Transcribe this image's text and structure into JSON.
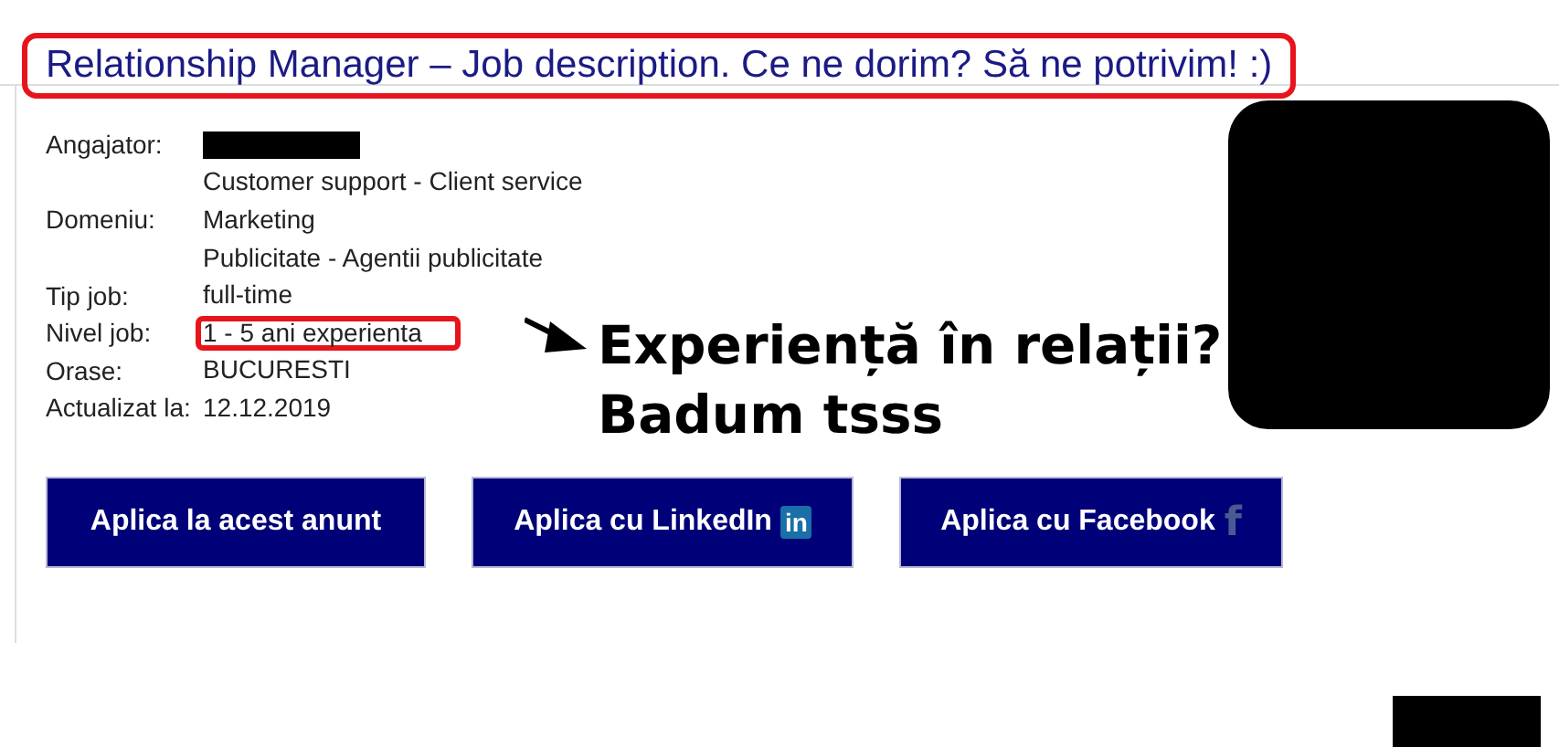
{
  "title": {
    "text": "Relationship Manager – Job description. Ce ne dorim? Să ne potrivim! :)",
    "highlighted": true
  },
  "details": [
    {
      "label": "Angajator:",
      "kind": "redacted"
    },
    {
      "value": "Customer support - Client service",
      "kind": "text"
    },
    {
      "label": "Domeniu:",
      "value": "Marketing",
      "kind": "text"
    },
    {
      "value": "Publicitate - Agentii publicitate",
      "kind": "text"
    },
    {
      "label": "Tip job:",
      "value": "full-time",
      "kind": "text"
    },
    {
      "label": "Nivel job:",
      "value": "1 - 5 ani experienta",
      "kind": "highlighted"
    },
    {
      "label": "Orase:",
      "value": "BUCURESTI",
      "kind": "text"
    },
    {
      "label": "Actualizat la:",
      "value": "12.12.2019",
      "kind": "text"
    }
  ],
  "annotation": {
    "lines": [
      "Experiență în relații?",
      "Badum tsss"
    ]
  },
  "buttons": [
    {
      "label": "Aplica la acest anunt",
      "kind": "plain"
    },
    {
      "label": "Aplica cu LinkedIn",
      "kind": "linkedin",
      "badge": "in"
    },
    {
      "label": "Aplica cu Facebook",
      "kind": "facebook",
      "badge": "f"
    }
  ]
}
